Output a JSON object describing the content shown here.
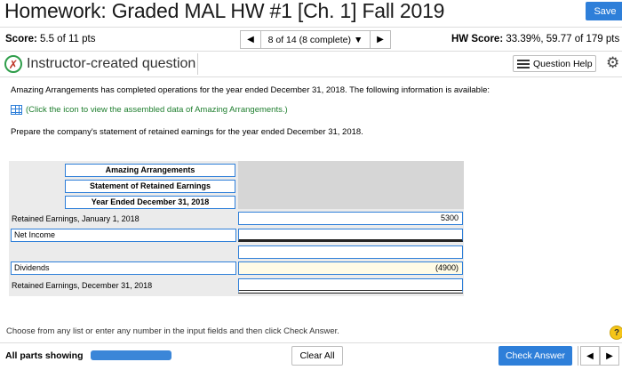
{
  "header": {
    "title": "Homework: Graded MAL HW #1 [Ch. 1] Fall 2019",
    "save_label": "Save"
  },
  "scorebar": {
    "score_label": "Score:",
    "score_value": "5.5 of 11 pts",
    "question_nav": "8 of 14 (8 complete)",
    "hw_score_label": "HW Score:",
    "hw_score_value": "33.39%, 59.77 of 179 pts"
  },
  "question_bar": {
    "label": "Instructor-created question",
    "help_label": "Question Help",
    "status_icon": "x-icon"
  },
  "problem": {
    "intro": "Amazing Arrangements has completed operations for the year ended December 31, 2018.  The following information is available:",
    "data_link": "(Click the icon to view the assembled data of Amazing Arrangements.)",
    "instruction": "Prepare the company's statement of retained earnings for the year ended December 31, 2018."
  },
  "worksheet": {
    "header_lines": [
      "Amazing Arrangements",
      "Statement of Retained Earnings",
      "Year Ended December 31, 2018"
    ],
    "rows": [
      {
        "label": "Retained Earnings, January 1, 2018",
        "amount": "5300"
      },
      {
        "label": "Net Income",
        "amount": ""
      },
      {
        "label": "",
        "amount": ""
      },
      {
        "label": "Dividends",
        "amount": "(4900)"
      },
      {
        "label": "Retained Earnings, December 31, 2018",
        "amount": ""
      }
    ]
  },
  "instructions_bottom": "Choose from any list or enter any number in the input fields and then click Check Answer.",
  "help_badge": "?",
  "footer": {
    "all_parts": "All parts showing",
    "clear_label": "Clear All",
    "check_label": "Check Answer"
  },
  "colors": {
    "accent": "#2e7fd9",
    "success": "#2f9e4b",
    "error": "#c0392b"
  }
}
